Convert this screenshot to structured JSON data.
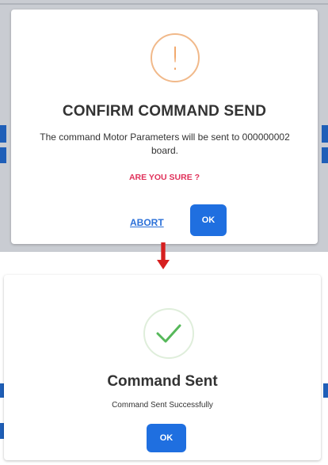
{
  "colors": {
    "warning_orange": "#f1a567",
    "success_green": "#56b85a",
    "primary_blue": "#1f6fe0",
    "link_blue": "#2b70d8",
    "confirm_red": "#e0315a",
    "arrow_red": "#d61f1f"
  },
  "dialog_confirm": {
    "icon": "exclamation-warning-icon",
    "icon_glyph": "!",
    "title": "CONFIRM COMMAND SEND",
    "message": "The command Motor Parameters will be sent to 000000002 board.",
    "confirm_text": "ARE YOU SURE ?",
    "abort_label": "ABORT",
    "ok_label": "OK"
  },
  "flow_arrow": "down-arrow-icon",
  "dialog_success": {
    "icon": "checkmark-success-icon",
    "title": "Command Sent",
    "message": "Command Sent Successfully",
    "ok_label": "OK"
  }
}
